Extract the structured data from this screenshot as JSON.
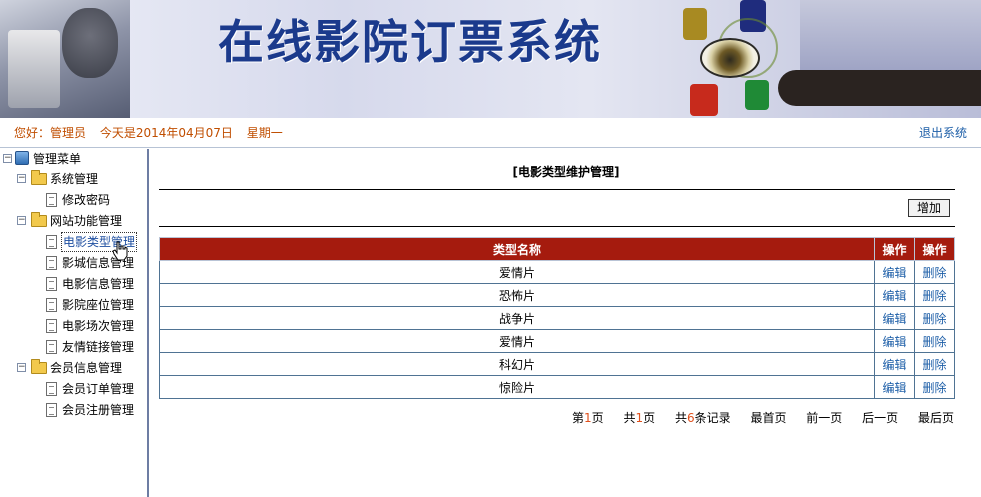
{
  "banner": {
    "title": "在线影院订票系统"
  },
  "info": {
    "greeting": "您好：管理员",
    "date": "今天是2014年04月07日",
    "weekday": "星期一",
    "logout": "退出系统"
  },
  "menu": {
    "root": "管理菜单",
    "groups": [
      {
        "label": "系统管理",
        "items": [
          "修改密码"
        ]
      },
      {
        "label": "网站功能管理",
        "items": [
          "电影类型管理",
          "影城信息管理",
          "电影信息管理",
          "影院座位管理",
          "电影场次管理",
          "友情链接管理"
        ]
      },
      {
        "label": "会员信息管理",
        "items": [
          "会员订单管理",
          "会员注册管理"
        ]
      }
    ]
  },
  "content": {
    "page_title": "[电影类型维护管理]",
    "add_button": "增加",
    "headers": [
      "类型名称",
      "操作",
      "操作"
    ],
    "rows": [
      {
        "name": "爱情片",
        "edit": "编辑",
        "delete": "删除"
      },
      {
        "name": "恐怖片",
        "edit": "编辑",
        "delete": "删除"
      },
      {
        "name": "战争片",
        "edit": "编辑",
        "delete": "删除"
      },
      {
        "name": "爱情片",
        "edit": "编辑",
        "delete": "删除"
      },
      {
        "name": "科幻片",
        "edit": "编辑",
        "delete": "删除"
      },
      {
        "name": "惊险片",
        "edit": "编辑",
        "delete": "删除"
      }
    ],
    "pager": {
      "page_prefix": "第",
      "page_num": "1",
      "page_suffix": "页",
      "total_prefix": "共",
      "total_pages": "1",
      "total_suffix": "页",
      "records_prefix": "共",
      "records": "6",
      "records_suffix": "条记录",
      "first": "最首页",
      "prev": "前一页",
      "next": "后一页",
      "last": "最后页"
    }
  },
  "colors": {
    "header_bg": "#a51b0e",
    "link": "#1e5fa8",
    "greeting": "#c04e00",
    "title": "#1b3a8c"
  }
}
